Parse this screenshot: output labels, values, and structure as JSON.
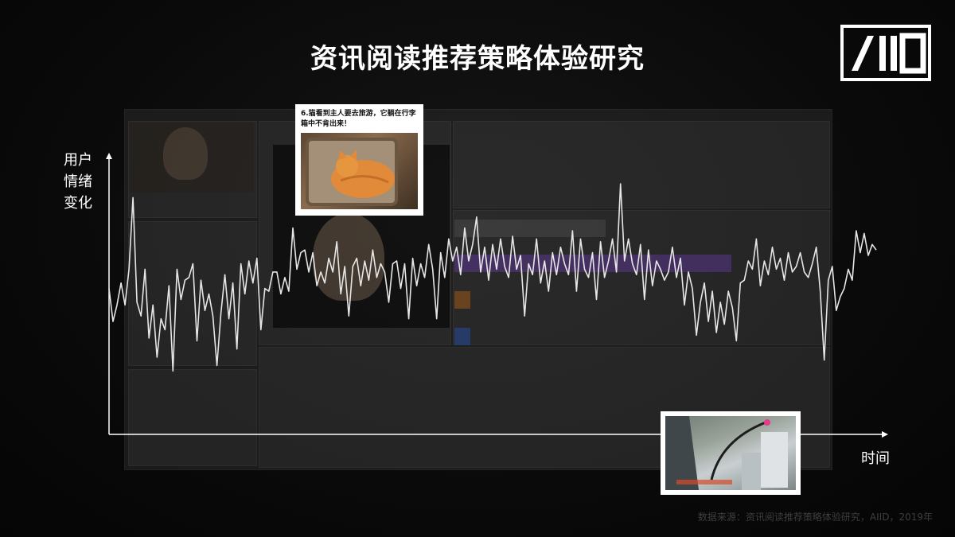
{
  "title": "资讯阅读推荐策略体验研究",
  "logo_text": "AIID",
  "source_note": "数据来源：资讯阅读推荐策略体验研究，AIID，2019年",
  "thumbnail_1": {
    "caption": "6.猫看到主人要去旅游，它躺在行李箱中不肯出来！",
    "icon": "cat-in-suitcase-photo"
  },
  "thumbnail_2": {
    "icon": "city-aerial-photo"
  },
  "colors": {
    "background": "#0a0a0a",
    "text": "#ffffff",
    "line": "#e6e6e6",
    "source_note": "#3e3e3e"
  },
  "chart_data": {
    "type": "line",
    "title": "",
    "ylabel_lines": [
      "用户",
      "情绪",
      "变化"
    ],
    "xlabel": "时间",
    "grid": false,
    "axis_ticks": false,
    "x_range": [
      0,
      191
    ],
    "ylim": [
      0,
      1
    ],
    "series": [
      {
        "values": [
          0.53,
          0.41,
          0.47,
          0.55,
          0.47,
          0.6,
          0.86,
          0.48,
          0.43,
          0.6,
          0.35,
          0.47,
          0.28,
          0.42,
          0.38,
          0.54,
          0.23,
          0.6,
          0.49,
          0.56,
          0.57,
          0.62,
          0.34,
          0.56,
          0.45,
          0.51,
          0.43,
          0.25,
          0.44,
          0.58,
          0.42,
          0.55,
          0.31,
          0.62,
          0.51,
          0.63,
          0.55,
          0.64,
          0.38,
          0.53,
          0.52,
          0.59,
          0.59,
          0.51,
          0.57,
          0.52,
          0.75,
          0.6,
          0.66,
          0.67,
          0.59,
          0.66,
          0.54,
          0.59,
          0.55,
          0.64,
          0.59,
          0.7,
          0.51,
          0.61,
          0.43,
          0.61,
          0.64,
          0.54,
          0.63,
          0.56,
          0.67,
          0.57,
          0.62,
          0.59,
          0.48,
          0.62,
          0.63,
          0.53,
          0.62,
          0.42,
          0.64,
          0.54,
          0.62,
          0.57,
          0.69,
          0.6,
          0.42,
          0.66,
          0.57,
          0.71,
          0.63,
          0.68,
          0.58,
          0.75,
          0.63,
          0.69,
          0.79,
          0.59,
          0.68,
          0.56,
          0.69,
          0.6,
          0.71,
          0.61,
          0.57,
          0.72,
          0.6,
          0.65,
          0.43,
          0.62,
          0.58,
          0.71,
          0.55,
          0.63,
          0.52,
          0.66,
          0.58,
          0.68,
          0.62,
          0.58,
          0.74,
          0.52,
          0.71,
          0.6,
          0.57,
          0.66,
          0.49,
          0.7,
          0.57,
          0.63,
          0.71,
          0.59,
          0.91,
          0.63,
          0.71,
          0.62,
          0.58,
          0.69,
          0.49,
          0.67,
          0.54,
          0.63,
          0.6,
          0.56,
          0.59,
          0.68,
          0.57,
          0.64,
          0.47,
          0.59,
          0.53,
          0.36,
          0.48,
          0.55,
          0.41,
          0.52,
          0.37,
          0.48,
          0.4,
          0.52,
          0.46,
          0.34,
          0.55,
          0.56,
          0.63,
          0.6,
          0.71,
          0.54,
          0.63,
          0.58,
          0.68,
          0.6,
          0.64,
          0.56,
          0.66,
          0.59,
          0.61,
          0.66,
          0.59,
          0.57,
          0.62,
          0.68,
          0.52,
          0.27,
          0.56,
          0.61,
          0.45,
          0.5,
          0.53,
          0.6,
          0.56,
          0.74,
          0.66,
          0.73,
          0.65,
          0.69,
          0.67
        ]
      }
    ]
  }
}
